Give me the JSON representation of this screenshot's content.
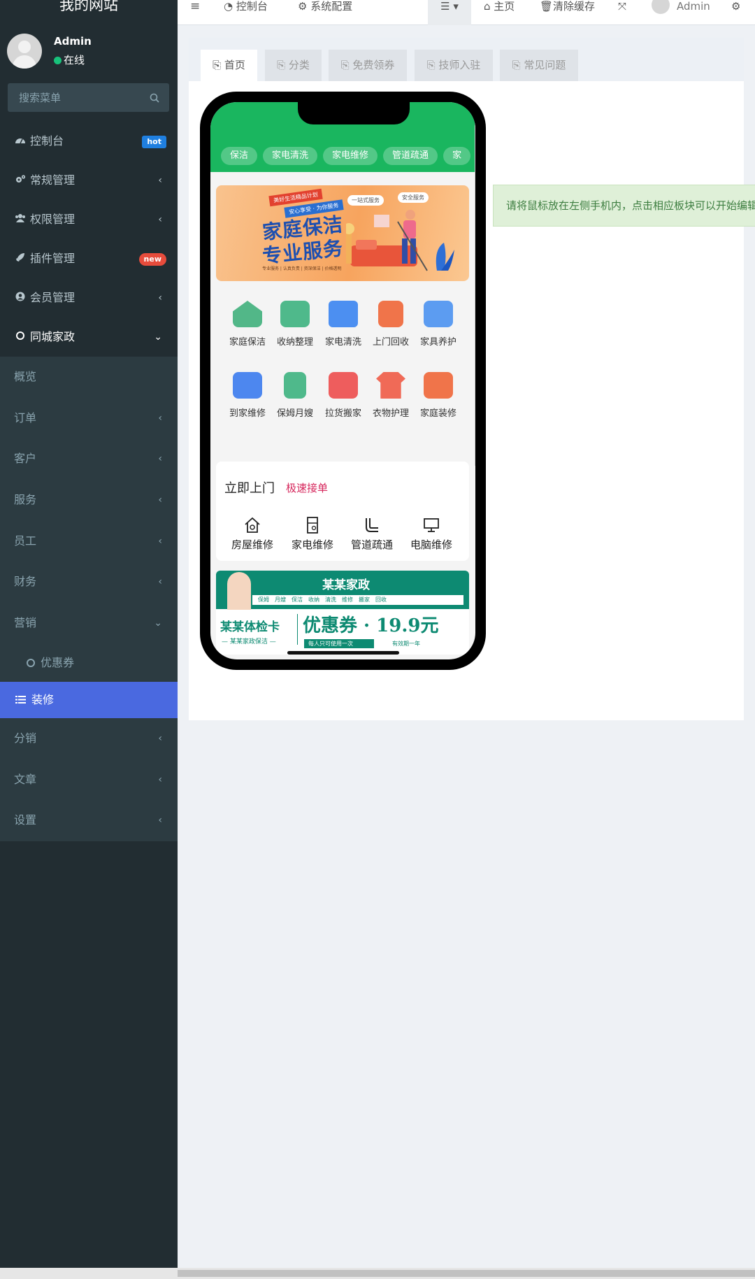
{
  "brand": "我的网站",
  "user": {
    "name": "Admin",
    "status": "在线"
  },
  "search": {
    "placeholder": "搜索菜单"
  },
  "menu": [
    {
      "label": "控制台",
      "badge": "hot"
    },
    {
      "label": "常规管理"
    },
    {
      "label": "权限管理"
    },
    {
      "label": "插件管理",
      "badge": "new"
    },
    {
      "label": "会员管理"
    },
    {
      "label": "同城家政"
    }
  ],
  "submenu": [
    {
      "label": "概览"
    },
    {
      "label": "订单"
    },
    {
      "label": "客户"
    },
    {
      "label": "服务"
    },
    {
      "label": "员工"
    },
    {
      "label": "财务"
    },
    {
      "label": "营销"
    },
    {
      "label": "优惠券"
    },
    {
      "label": "装修"
    },
    {
      "label": "分销"
    },
    {
      "label": "文章"
    },
    {
      "label": "设置"
    }
  ],
  "topbar": {
    "console": "控制台",
    "sysconfig": "系统配置",
    "home": "主页",
    "clear_cache": "清除缓存",
    "admin": "Admin"
  },
  "tabs": [
    "首页",
    "分类",
    "免费领券",
    "技师入驻",
    "常见问题"
  ],
  "phone": {
    "chips": [
      "保洁",
      "家电清洗",
      "家电维修",
      "管道疏通",
      "家"
    ],
    "banner": {
      "tag": "美好生活精品计划",
      "sub": "安心享受 · 为你服务",
      "title1": "家庭保洁",
      "title2": "专业服务",
      "bubble1": "一站式服务",
      "bubble2": "安全服务",
      "footer": "专业服务 | 认真负责 | 资深保洁 | 价格透明"
    },
    "grid": [
      "家庭保洁",
      "收纳整理",
      "家电清洗",
      "上门回收",
      "家具养护",
      "到家维修",
      "保姆月嫂",
      "拉货搬家",
      "衣物护理",
      "家庭装修"
    ],
    "card": {
      "title": "立即上门",
      "subtitle": "极速接单",
      "items": [
        "房屋维修",
        "家电维修",
        "管道疏通",
        "电脑维修"
      ]
    },
    "promo": {
      "brand": "某某家政",
      "services": "保姆　月嫂　保洁　收纳　清洗　维修　搬家　回收",
      "card_name": "某某体检卡",
      "card_sub": "— 某某家政保洁 —",
      "coupon": "优惠券 · 19.9元",
      "rule": "每人只可使用一次",
      "valid": "有效期一年"
    }
  },
  "alert": "请将鼠标放在左侧手机内，点击相应板块可以开始编辑",
  "colors": {
    "sidebar": "#222d32",
    "active": "#4a69e0",
    "green": "#1ab65f"
  }
}
